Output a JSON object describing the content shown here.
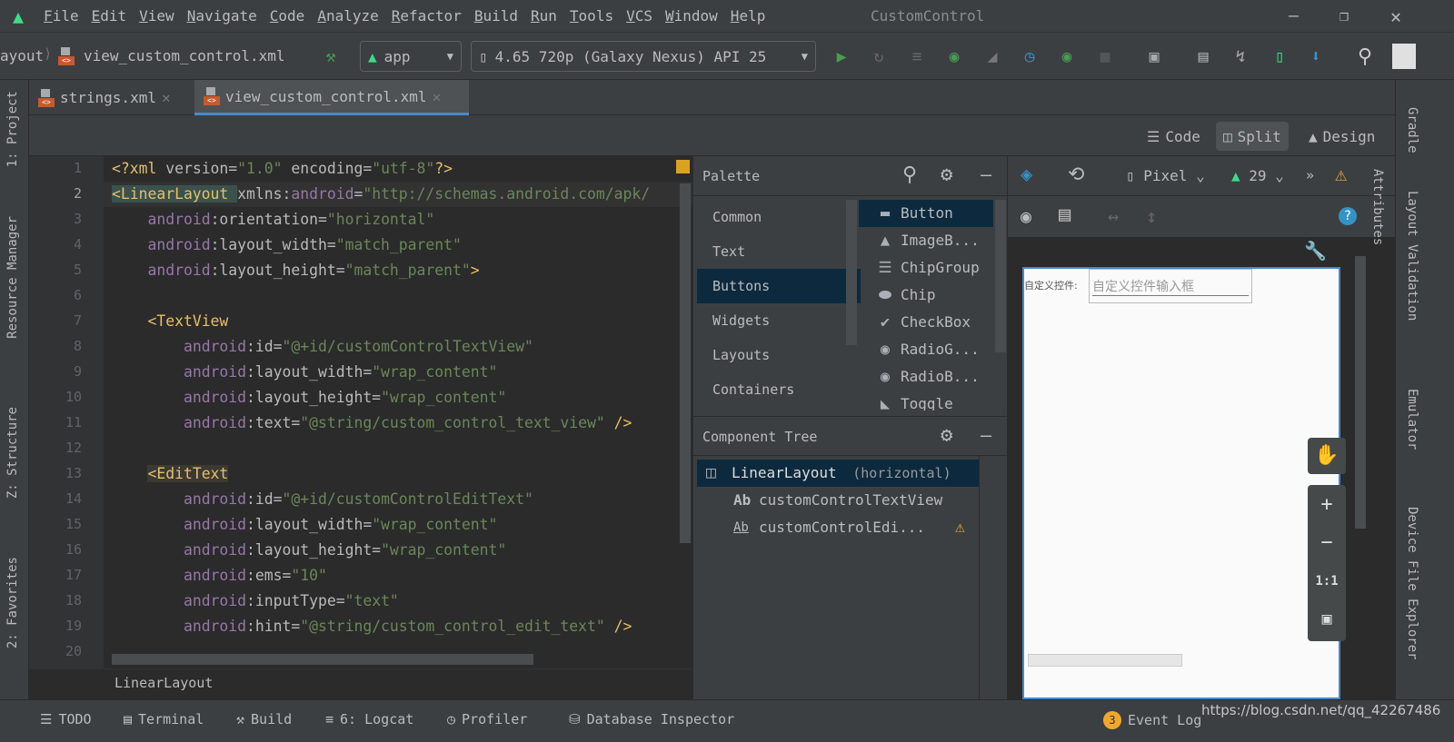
{
  "window": {
    "title": "CustomControl",
    "menu": [
      "File",
      "Edit",
      "View",
      "Navigate",
      "Code",
      "Analyze",
      "Refactor",
      "Build",
      "Run",
      "Tools",
      "VCS",
      "Window",
      "Help"
    ],
    "controls": [
      "minimize",
      "restore",
      "close"
    ]
  },
  "toolbar": {
    "breadcrumb_parent": "ayout",
    "breadcrumb_file": "view_custom_control.xml",
    "run_config": "app",
    "device": "4.65 720p (Galaxy Nexus) API 25",
    "icons": [
      "hammer-icon",
      "run-icon",
      "apply-changes-icon",
      "apply-code-changes-icon",
      "debug-icon",
      "attach-icon",
      "profile-icon",
      "attach-debugger-icon",
      "stop-icon",
      "project-structure-icon",
      "terminal-icon",
      "gradle-sync-icon",
      "avd-manager-icon",
      "sdk-manager-icon",
      "search-icon",
      "avatar"
    ]
  },
  "tabs": [
    {
      "label": "strings.xml",
      "active": false
    },
    {
      "label": "view_custom_control.xml",
      "active": true
    }
  ],
  "left_tools": [
    "1: Project",
    "Resource Manager",
    "Z: Structure",
    "2: Favorites"
  ],
  "right_tools": [
    "Gradle",
    "Layout Validation",
    "Emulator",
    "Device File Explorer"
  ],
  "view_modes": {
    "code": "Code",
    "split": "Split",
    "design": "Design",
    "active": "Split"
  },
  "editor": {
    "lines": [
      [
        [
          "t-tag",
          "<?xml "
        ],
        [
          "t-at",
          "version="
        ],
        [
          "t-val",
          "\"1.0\""
        ],
        [
          "t-at",
          " encoding="
        ],
        [
          "t-val",
          "\"utf-8\""
        ],
        [
          "t-tag",
          "?>"
        ]
      ],
      [
        [
          "t-tag",
          "<LinearLayout "
        ],
        [
          "t-at",
          "xmlns:"
        ],
        [
          "t-ns",
          "android"
        ],
        [
          "t-at",
          "="
        ],
        [
          "t-val",
          "\"http://schemas.android.com/apk/"
        ]
      ],
      [
        [
          "t-pl",
          "    "
        ],
        [
          "t-ns",
          "android"
        ],
        [
          "t-at",
          ":orientation="
        ],
        [
          "t-val",
          "\"horizontal\""
        ]
      ],
      [
        [
          "t-pl",
          "    "
        ],
        [
          "t-ns",
          "android"
        ],
        [
          "t-at",
          ":layout_width="
        ],
        [
          "t-val",
          "\"match_parent\""
        ]
      ],
      [
        [
          "t-pl",
          "    "
        ],
        [
          "t-ns",
          "android"
        ],
        [
          "t-at",
          ":layout_height="
        ],
        [
          "t-val",
          "\"match_parent\""
        ],
        [
          "t-tag",
          ">"
        ]
      ],
      [],
      [
        [
          "t-pl",
          "    "
        ],
        [
          "t-tag",
          "<TextView"
        ]
      ],
      [
        [
          "t-pl",
          "        "
        ],
        [
          "t-ns",
          "android"
        ],
        [
          "t-at",
          ":id="
        ],
        [
          "t-val",
          "\"@+id/customControlTextView\""
        ]
      ],
      [
        [
          "t-pl",
          "        "
        ],
        [
          "t-ns",
          "android"
        ],
        [
          "t-at",
          ":layout_width="
        ],
        [
          "t-val",
          "\"wrap_content\""
        ]
      ],
      [
        [
          "t-pl",
          "        "
        ],
        [
          "t-ns",
          "android"
        ],
        [
          "t-at",
          ":layout_height="
        ],
        [
          "t-val",
          "\"wrap_content\""
        ]
      ],
      [
        [
          "t-pl",
          "        "
        ],
        [
          "t-ns",
          "android"
        ],
        [
          "t-at",
          ":text="
        ],
        [
          "t-val",
          "\"@string/custom_control_text_view\""
        ],
        [
          "t-tag",
          " />"
        ]
      ],
      [],
      [
        [
          "t-pl",
          "    "
        ],
        [
          "t-tag",
          "<EditText"
        ]
      ],
      [
        [
          "t-pl",
          "        "
        ],
        [
          "t-ns",
          "android"
        ],
        [
          "t-at",
          ":id="
        ],
        [
          "t-val",
          "\"@+id/customControlEditText\""
        ]
      ],
      [
        [
          "t-pl",
          "        "
        ],
        [
          "t-ns",
          "android"
        ],
        [
          "t-at",
          ":layout_width="
        ],
        [
          "t-val",
          "\"wrap_content\""
        ]
      ],
      [
        [
          "t-pl",
          "        "
        ],
        [
          "t-ns",
          "android"
        ],
        [
          "t-at",
          ":layout_height="
        ],
        [
          "t-val",
          "\"wrap_content\""
        ]
      ],
      [
        [
          "t-pl",
          "        "
        ],
        [
          "t-ns",
          "android"
        ],
        [
          "t-at",
          ":ems="
        ],
        [
          "t-val",
          "\"10\""
        ]
      ],
      [
        [
          "t-pl",
          "        "
        ],
        [
          "t-ns",
          "android"
        ],
        [
          "t-at",
          ":inputType="
        ],
        [
          "t-val",
          "\"text\""
        ]
      ],
      [
        [
          "t-pl",
          "        "
        ],
        [
          "t-ns",
          "android"
        ],
        [
          "t-at",
          ":hint="
        ],
        [
          "t-val",
          "\"@string/custom_control_edit_text\""
        ],
        [
          "t-tag",
          " />"
        ]
      ],
      []
    ],
    "breadcrumb": "LinearLayout"
  },
  "palette": {
    "title": "Palette",
    "categories": [
      "Common",
      "Text",
      "Buttons",
      "Widgets",
      "Layouts",
      "Containers"
    ],
    "selected_category": "Buttons",
    "items": [
      {
        "label": "Button",
        "icon": "button-icon",
        "g": "▬"
      },
      {
        "label": "ImageB...",
        "icon": "image-icon",
        "g": "▲"
      },
      {
        "label": "ChipGroup",
        "icon": "chipgroup-icon",
        "g": "☰"
      },
      {
        "label": "Chip",
        "icon": "chip-icon",
        "g": "⬬"
      },
      {
        "label": "CheckBox",
        "icon": "check-icon",
        "g": "✔"
      },
      {
        "label": "RadioG...",
        "icon": "radio-icon",
        "g": "◉"
      },
      {
        "label": "RadioB...",
        "icon": "radio-icon",
        "g": "◉"
      },
      {
        "label": "Toggle",
        "icon": "toggle-icon",
        "g": "◣"
      }
    ]
  },
  "component_tree": {
    "title": "Component Tree",
    "root": "LinearLayout",
    "root_hint": "(horizontal)",
    "children": [
      "customControlTextView",
      "customControlEdi..."
    ]
  },
  "design": {
    "device": "Pixel",
    "api": "29",
    "preview_label": "自定义控件:",
    "preview_hint": "自定义控件输入框",
    "zoom_controls": [
      "+",
      "−",
      "1:1"
    ]
  },
  "status": {
    "items": [
      "TODO",
      "Terminal",
      "Build",
      "6: Logcat",
      "Profiler",
      "Database Inspector"
    ],
    "event_count": "3",
    "event_log": "Event Log",
    "watermark": "https://blog.csdn.net/qq_42267486"
  },
  "colors": {
    "accent": "#4a88c7",
    "android_green": "#3ddc84",
    "warning": "#f0a732"
  }
}
